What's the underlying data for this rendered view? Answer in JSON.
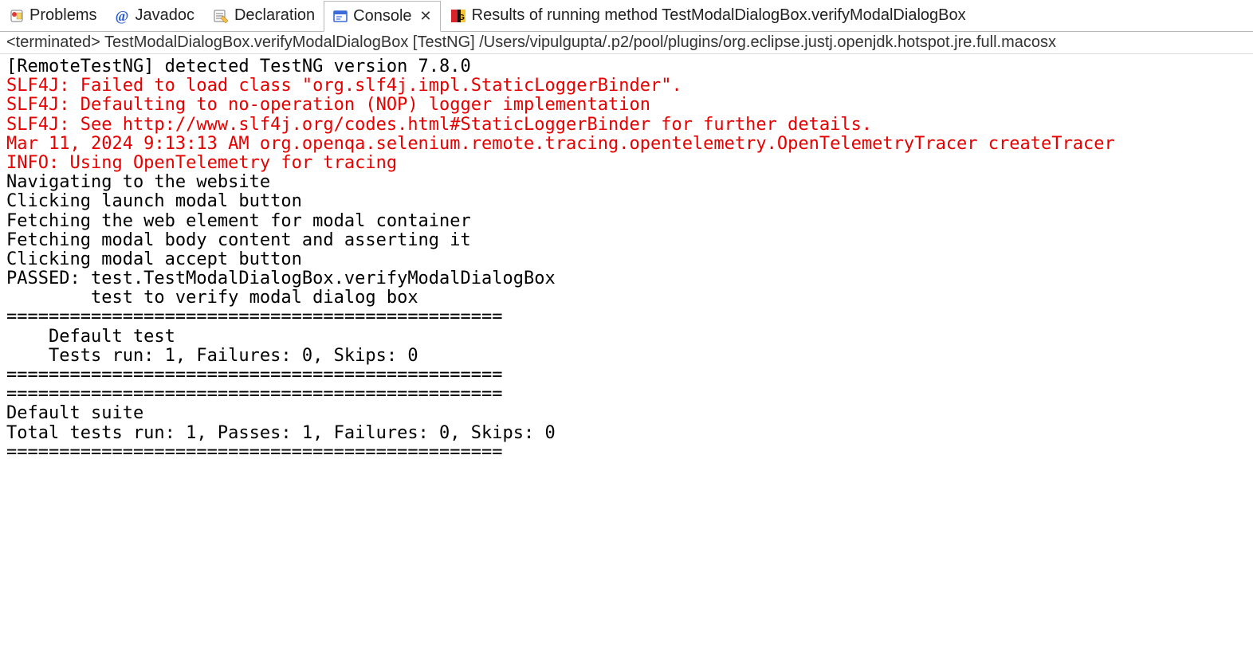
{
  "tabs": {
    "problems": "Problems",
    "javadoc": "Javadoc",
    "declaration": "Declaration",
    "console": "Console",
    "results": "Results of running method TestModalDialogBox.verifyModalDialogBox"
  },
  "status_line": "<terminated> TestModalDialogBox.verifyModalDialogBox [TestNG] /Users/vipulgupta/.p2/pool/plugins/org.eclipse.justj.openjdk.hotspot.jre.full.macosx",
  "console_lines": [
    {
      "cls": "",
      "text": "[RemoteTestNG] detected TestNG version 7.8.0"
    },
    {
      "cls": "err",
      "text": "SLF4J: Failed to load class \"org.slf4j.impl.StaticLoggerBinder\"."
    },
    {
      "cls": "err",
      "text": "SLF4J: Defaulting to no-operation (NOP) logger implementation"
    },
    {
      "cls": "err",
      "text": "SLF4J: See http://www.slf4j.org/codes.html#StaticLoggerBinder for further details."
    },
    {
      "cls": "err",
      "text": "Mar 11, 2024 9:13:13 AM org.openqa.selenium.remote.tracing.opentelemetry.OpenTelemetryTracer createTracer"
    },
    {
      "cls": "err",
      "text": "INFO: Using OpenTelemetry for tracing"
    },
    {
      "cls": "",
      "text": "Navigating to the website"
    },
    {
      "cls": "",
      "text": "Clicking launch modal button"
    },
    {
      "cls": "",
      "text": "Fetching the web element for modal container"
    },
    {
      "cls": "",
      "text": "Fetching modal body content and asserting it"
    },
    {
      "cls": "",
      "text": "Clicking modal accept button"
    },
    {
      "cls": "",
      "text": "PASSED: test.TestModalDialogBox.verifyModalDialogBox"
    },
    {
      "cls": "",
      "text": "        test to verify modal dialog box"
    },
    {
      "cls": "",
      "text": ""
    },
    {
      "cls": "",
      "text": "==============================================="
    },
    {
      "cls": "",
      "text": "    Default test"
    },
    {
      "cls": "",
      "text": "    Tests run: 1, Failures: 0, Skips: 0"
    },
    {
      "cls": "",
      "text": "==============================================="
    },
    {
      "cls": "",
      "text": ""
    },
    {
      "cls": "",
      "text": ""
    },
    {
      "cls": "",
      "text": "==============================================="
    },
    {
      "cls": "",
      "text": "Default suite"
    },
    {
      "cls": "",
      "text": "Total tests run: 1, Passes: 1, Failures: 0, Skips: 0"
    },
    {
      "cls": "",
      "text": "==============================================="
    }
  ]
}
